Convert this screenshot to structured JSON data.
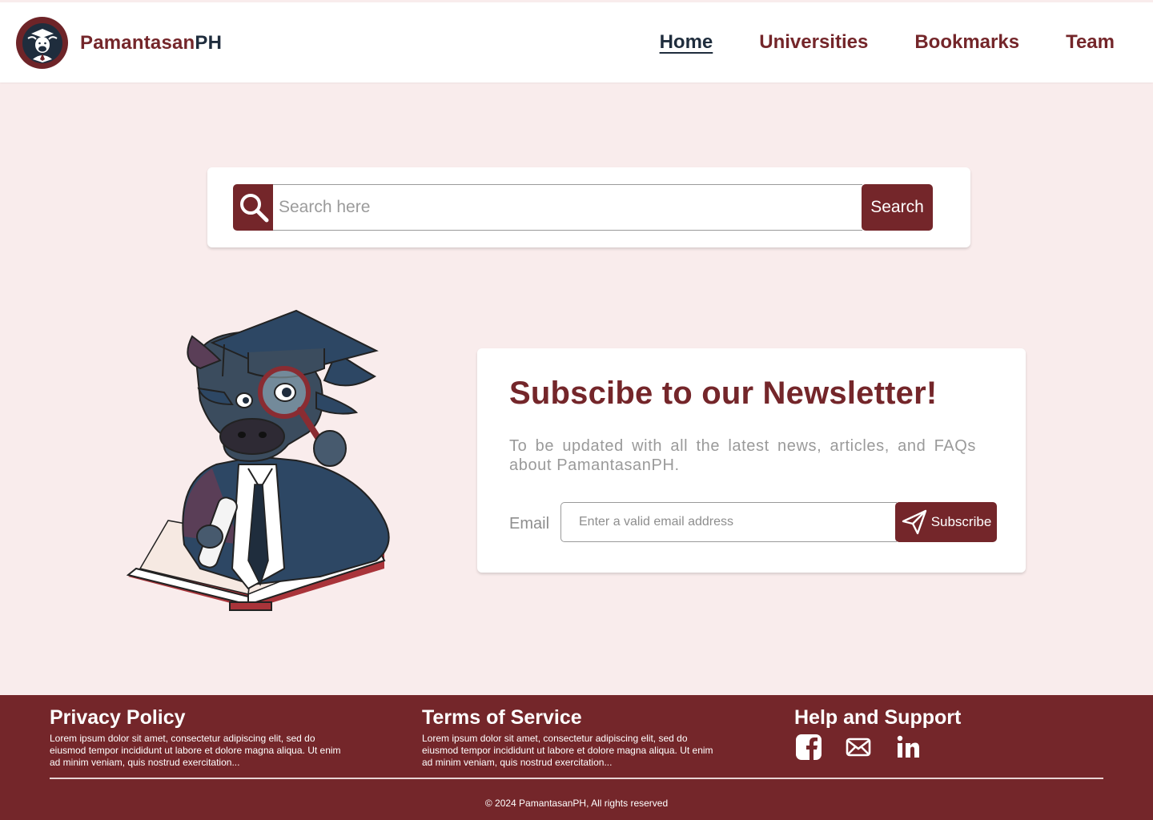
{
  "brand": {
    "name_part1": "Pamantasan",
    "name_part2": "PH",
    "logo_icon": "carabao-graduate-logo"
  },
  "nav": {
    "items": [
      {
        "label": "Home",
        "active": true
      },
      {
        "label": "Universities",
        "active": false
      },
      {
        "label": "Bookmarks",
        "active": false
      },
      {
        "label": "Team",
        "active": false
      }
    ]
  },
  "search": {
    "placeholder": "Search here",
    "value": "",
    "button_label": "Search",
    "icon": "magnifier-icon"
  },
  "mascot": {
    "description_icon": "carabao-scholar-mascot"
  },
  "newsletter": {
    "title": "Subscibe to our Newsletter!",
    "description": "To be updated with all the latest news, articles, and FAQs about PamantasanPH.",
    "email_label": "Email",
    "email_placeholder": "Enter a valid email address",
    "button_label": "Subscribe",
    "button_icon": "paper-plane-icon"
  },
  "footer": {
    "privacy": {
      "title": "Privacy Policy",
      "text": "Lorem ipsum dolor sit amet, consectetur adipiscing elit, sed do eiusmod tempor incididunt ut labore et dolore magna aliqua. Ut enim ad minim veniam, quis nostrud exercitation..."
    },
    "terms": {
      "title": "Terms of Service",
      "text": "Lorem ipsum dolor sit amet, consectetur adipiscing elit, sed do eiusmod tempor incididunt ut labore et dolore magna aliqua. Ut enim ad minim veniam, quis nostrud exercitation..."
    },
    "help": {
      "title": "Help and Support",
      "icons": [
        "facebook-icon",
        "mail-icon",
        "linkedin-icon"
      ]
    },
    "copyright": "© 2024 PamantasanPH, All rights reserved"
  },
  "colors": {
    "maroon": "#74262a",
    "navy": "#1f2d3d",
    "background": "#f9ecec",
    "muted_text": "#9a9a9a"
  }
}
